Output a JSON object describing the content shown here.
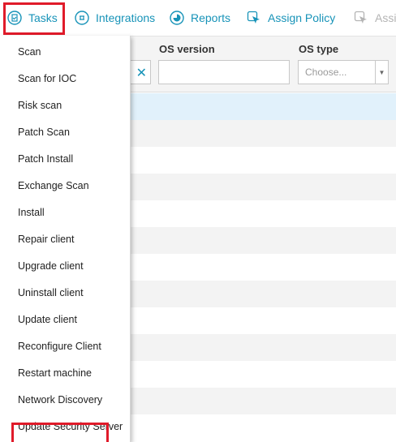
{
  "toolbar": {
    "tasks_label": "Tasks",
    "integrations_label": "Integrations",
    "reports_label": "Reports",
    "assign_policy_label": "Assign Policy",
    "assign_truncated_label": "Assi"
  },
  "grid": {
    "columns": [
      {
        "label": "OS version"
      },
      {
        "label": "OS type"
      }
    ],
    "os_type_placeholder": "Choose...",
    "clear_glyph": "✕"
  },
  "tasks_menu": {
    "items": [
      {
        "label": "Scan"
      },
      {
        "label": "Scan for IOC"
      },
      {
        "label": "Risk scan"
      },
      {
        "label": "Patch Scan"
      },
      {
        "label": "Patch Install"
      },
      {
        "label": "Exchange Scan"
      },
      {
        "label": "Install"
      },
      {
        "label": "Repair client"
      },
      {
        "label": "Upgrade client"
      },
      {
        "label": "Uninstall client"
      },
      {
        "label": "Update client"
      },
      {
        "label": "Reconfigure Client"
      },
      {
        "label": "Restart machine"
      },
      {
        "label": "Network Discovery"
      },
      {
        "label": "Update Security Server"
      }
    ],
    "highlighted_item": "Network Discovery"
  },
  "colors": {
    "accent": "#1793b8",
    "highlight_box": "#e01b2a",
    "selected_row": "#e1f1fb"
  },
  "icons": {
    "tasks": "clipboard-check-icon",
    "integrations": "integrations-icon",
    "reports": "pie-chart-icon",
    "assign_policy": "cursor-policy-icon"
  }
}
